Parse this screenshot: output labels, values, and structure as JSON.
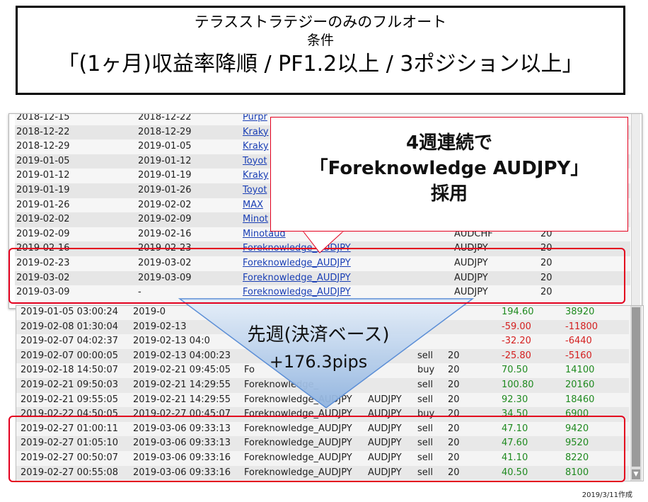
{
  "title": {
    "line1": "テラスストラテジーのみのフルオート",
    "line2": "条件",
    "line3": "「(1ヶ月)収益率降順 / PF1.2以上 / 3ポジション以上」"
  },
  "strategy_table": {
    "rows": [
      {
        "start": "2018-12-15",
        "end": "2018-12-22",
        "strategy": "Purpr",
        "pair": "",
        "amount": ""
      },
      {
        "start": "2018-12-22",
        "end": "2018-12-29",
        "strategy": "Kraky",
        "pair": "",
        "amount": ""
      },
      {
        "start": "2018-12-29",
        "end": "2019-01-05",
        "strategy": "Kraky",
        "pair": "",
        "amount": ""
      },
      {
        "start": "2019-01-05",
        "end": "2019-01-12",
        "strategy": "Toyot",
        "pair": "",
        "amount": ""
      },
      {
        "start": "2019-01-12",
        "end": "2019-01-19",
        "strategy": "Kraky",
        "pair": "",
        "amount": ""
      },
      {
        "start": "2019-01-19",
        "end": "2019-01-26",
        "strategy": "Toyot",
        "pair": "",
        "amount": ""
      },
      {
        "start": "2019-01-26",
        "end": "2019-02-02",
        "strategy": "MAX",
        "pair": "",
        "amount": ""
      },
      {
        "start": "2019-02-02",
        "end": "2019-02-09",
        "strategy": "Minot",
        "pair": "",
        "amount": ""
      },
      {
        "start": "2019-02-09",
        "end": "2019-02-16",
        "strategy": "Minotaud",
        "pair": "AUDCHF",
        "amount": "20"
      },
      {
        "start": "2019-02-16",
        "end": "2019-02-23",
        "strategy": "Foreknowledge_AUDJPY",
        "pair": "AUDJPY",
        "amount": "20"
      },
      {
        "start": "2019-02-23",
        "end": "2019-03-02",
        "strategy": "Foreknowledge_AUDJPY",
        "pair": "AUDJPY",
        "amount": "20"
      },
      {
        "start": "2019-03-02",
        "end": "2019-03-09",
        "strategy": "Foreknowledge_AUDJPY",
        "pair": "AUDJPY",
        "amount": "20"
      },
      {
        "start": "2019-03-09",
        "end": "-",
        "strategy": "Foreknowledge_AUDJPY",
        "pair": "AUDJPY",
        "amount": "20"
      }
    ]
  },
  "trade_table": {
    "rows": [
      {
        "open": "2019-01-05 03:00:24",
        "close": "2019-0",
        "strategy": "",
        "pair": "",
        "side": "",
        "amount": "",
        "pips": "194.60",
        "profit": "38920",
        "sign": "pos"
      },
      {
        "open": "2019-02-08 01:30:04",
        "close": "2019-02-13",
        "strategy": "",
        "pair": "",
        "side": "",
        "amount": "",
        "pips": "-59.00",
        "profit": "-11800",
        "sign": "neg"
      },
      {
        "open": "2019-02-07 04:02:37",
        "close": "2019-02-13 04:0",
        "strategy": "",
        "pair": "",
        "side": "",
        "amount": "",
        "pips": "-32.20",
        "profit": "-6440",
        "sign": "neg"
      },
      {
        "open": "2019-02-07 00:00:05",
        "close": "2019-02-13 04:00:23",
        "strategy": "",
        "pair": "",
        "side": "sell",
        "amount": "20",
        "pips": "-25.80",
        "profit": "-5160",
        "sign": "neg"
      },
      {
        "open": "2019-02-18 14:50:07",
        "close": "2019-02-21 09:45:05",
        "strategy": "Fo",
        "pair": "",
        "side": "buy",
        "amount": "20",
        "pips": "70.50",
        "profit": "14100",
        "sign": "pos"
      },
      {
        "open": "2019-02-21 09:50:03",
        "close": "2019-02-21 14:29:55",
        "strategy": "Foreknowledge_",
        "pair": "",
        "side": "sell",
        "amount": "20",
        "pips": "100.80",
        "profit": "20160",
        "sign": "pos"
      },
      {
        "open": "2019-02-21 09:55:05",
        "close": "2019-02-21 14:29:55",
        "strategy": "Foreknowledge_AUDJPY",
        "pair": "AUDJPY",
        "side": "sell",
        "amount": "20",
        "pips": "92.30",
        "profit": "18460",
        "sign": "pos"
      },
      {
        "open": "2019-02-22 04:50:05",
        "close": "2019-02-27 00:45:07",
        "strategy": "Foreknowledge_AUDJPY",
        "pair": "AUDJPY",
        "side": "buy",
        "amount": "20",
        "pips": "34.50",
        "profit": "6900",
        "sign": "pos"
      },
      {
        "open": "2019-02-27 01:00:11",
        "close": "2019-03-06 09:33:13",
        "strategy": "Foreknowledge_AUDJPY",
        "pair": "AUDJPY",
        "side": "sell",
        "amount": "20",
        "pips": "47.10",
        "profit": "9420",
        "sign": "pos"
      },
      {
        "open": "2019-02-27 01:05:10",
        "close": "2019-03-06 09:33:13",
        "strategy": "Foreknowledge_AUDJPY",
        "pair": "AUDJPY",
        "side": "sell",
        "amount": "20",
        "pips": "47.60",
        "profit": "9520",
        "sign": "pos"
      },
      {
        "open": "2019-02-27 00:50:07",
        "close": "2019-03-06 09:33:16",
        "strategy": "Foreknowledge_AUDJPY",
        "pair": "AUDJPY",
        "side": "sell",
        "amount": "20",
        "pips": "41.10",
        "profit": "8220",
        "sign": "pos"
      },
      {
        "open": "2019-02-27 00:55:08",
        "close": "2019-03-06 09:33:16",
        "strategy": "Foreknowledge_AUDJPY",
        "pair": "AUDJPY",
        "side": "sell",
        "amount": "20",
        "pips": "40.50",
        "profit": "8100",
        "sign": "pos"
      }
    ]
  },
  "callout": {
    "line1": "4週連続で",
    "line2": "「Foreknowledge AUDJPY」",
    "line3": "採用"
  },
  "arrow_label": {
    "line1": "先週(決済ベース)",
    "line2": "+176.3pips"
  },
  "footnote": "2019/3/11作成",
  "colors": {
    "highlight": "#e3001e",
    "positive": "#1f8a1f",
    "negative": "#d42020",
    "link": "#1a3fb5"
  }
}
